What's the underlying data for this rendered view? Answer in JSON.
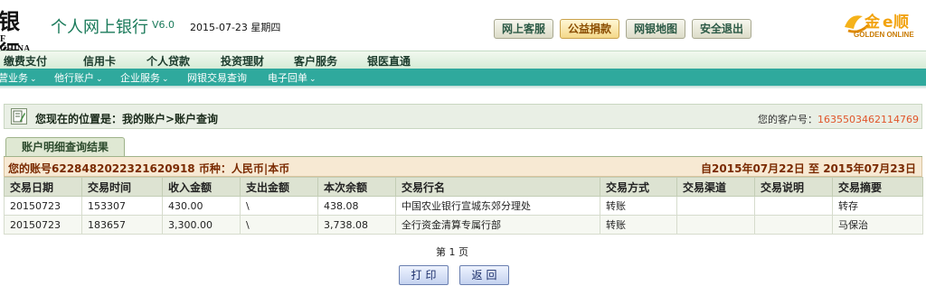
{
  "header": {
    "bank_name": "银行",
    "bank_name_en": "F CHINA",
    "site_title": "个人网上银行",
    "version": "V6.0",
    "date": "2015-07-23 星期四",
    "buttons": [
      {
        "label": "网上客服",
        "highlight": false
      },
      {
        "label": "公益捐款",
        "highlight": true
      },
      {
        "label": "网银地图",
        "highlight": false
      },
      {
        "label": "安全退出",
        "highlight": false
      }
    ],
    "partner_logo": {
      "name": "金e顺",
      "sub": "GOLDEN ONLINE",
      "icon": "golden-online-logo"
    }
  },
  "nav_primary": [
    "缴费支付",
    "信用卡",
    "个人贷款",
    "投资理财",
    "客户服务",
    "银医直通"
  ],
  "nav_secondary": [
    "营业务",
    "他行账户",
    "企业服务",
    "网银交易查询",
    "电子回单"
  ],
  "breadcrumb": {
    "icon": "document-edit-icon",
    "text": "您现在的位置是：我的账户>账户查询",
    "customer_label": "您的客户号：",
    "customer_no": "1635503462114769"
  },
  "tab": {
    "label": "账户明细查询结果"
  },
  "summary": {
    "account": "您的账号6228482022321620918 币种：人民币|本币",
    "period": "自2015年07月22日  至  2015年07月23日"
  },
  "table": {
    "columns": [
      "交易日期",
      "交易时间",
      "收入金额",
      "支出金额",
      "本次余额",
      "交易行名",
      "交易方式",
      "交易渠道",
      "交易说明",
      "交易摘要"
    ],
    "rows": [
      [
        "20150723",
        "153307",
        "430.00",
        "\\",
        "438.08",
        "中国农业银行宣城东郊分理处",
        "转账",
        "",
        "",
        "转存"
      ],
      [
        "20150723",
        "183657",
        "3,300.00",
        "\\",
        "3,738.08",
        "全行资金清算专属行部",
        "转账",
        "",
        "",
        "马保治"
      ]
    ]
  },
  "pagination": {
    "text": "第 1 页"
  },
  "actions": {
    "print": "打印",
    "back": "返回"
  },
  "colors": {
    "accent": "#2fa99d",
    "orange": "#e0552a",
    "summary_text": "#7a2a00"
  }
}
